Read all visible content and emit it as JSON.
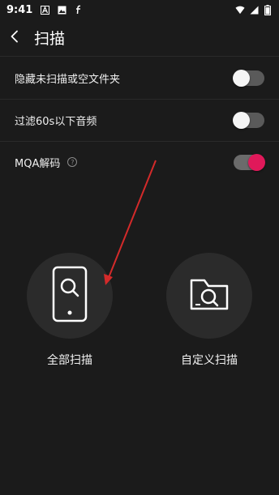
{
  "status_bar": {
    "time": "9:41",
    "icons_left": [
      "a-letter-icon",
      "image-icon",
      "f-letter-icon"
    ],
    "icons_right": [
      "wifi-icon",
      "signal-icon",
      "battery-icon"
    ]
  },
  "header": {
    "title": "扫描",
    "back_icon": "back-arrow-icon"
  },
  "settings": [
    {
      "label": "隐藏未扫描或空文件夹",
      "toggle_on": false
    },
    {
      "label": "过滤60s以下音频",
      "toggle_on": false
    },
    {
      "label": "MQA解码",
      "has_help": true,
      "help_glyph": "?",
      "toggle_on": true
    }
  ],
  "scan_options": [
    {
      "label": "全部扫描",
      "icon": "phone-search-icon"
    },
    {
      "label": "自定义扫描",
      "icon": "folder-search-icon"
    }
  ],
  "colors": {
    "background": "#1b1b1b",
    "accent": "#e0195a",
    "annotation_arrow": "#d42a2a"
  }
}
